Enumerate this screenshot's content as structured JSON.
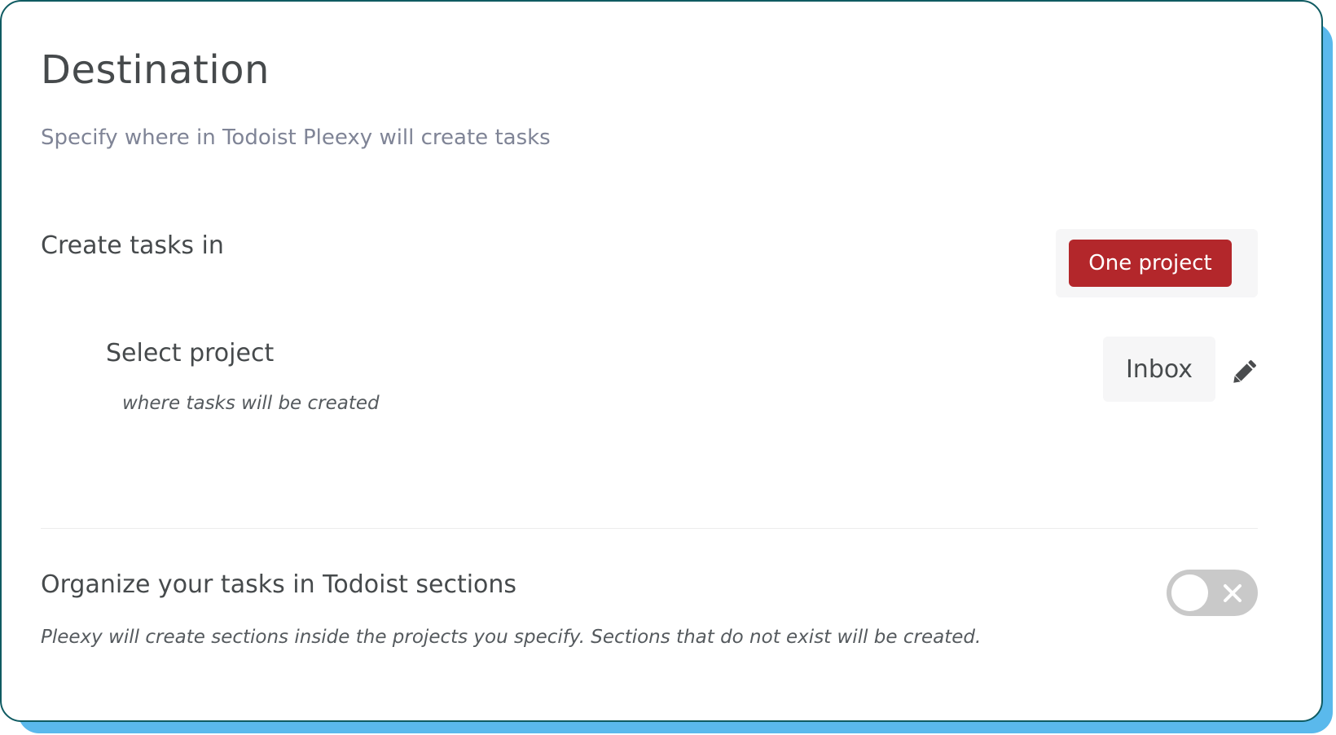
{
  "header": {
    "title": "Destination",
    "subtitle": "Specify where in Todoist Pleexy will create tasks"
  },
  "create_tasks": {
    "label": "Create tasks in",
    "selected_option": "One project"
  },
  "select_project": {
    "label": "Select project",
    "hint": "where tasks will be created",
    "value": "Inbox",
    "edit_icon": "pencil-icon"
  },
  "sections": {
    "label": "Organize your tasks in Todoist sections",
    "hint": "Pleexy will create sections inside the projects you specify. Sections that do not exist will be created.",
    "enabled": false,
    "toggle_icon": "x-icon"
  },
  "colors": {
    "accent": "#b3272b",
    "card_border": "#0f5b62",
    "shadow": "#5ab9ec",
    "toggle_off": "#c9c9c9"
  }
}
